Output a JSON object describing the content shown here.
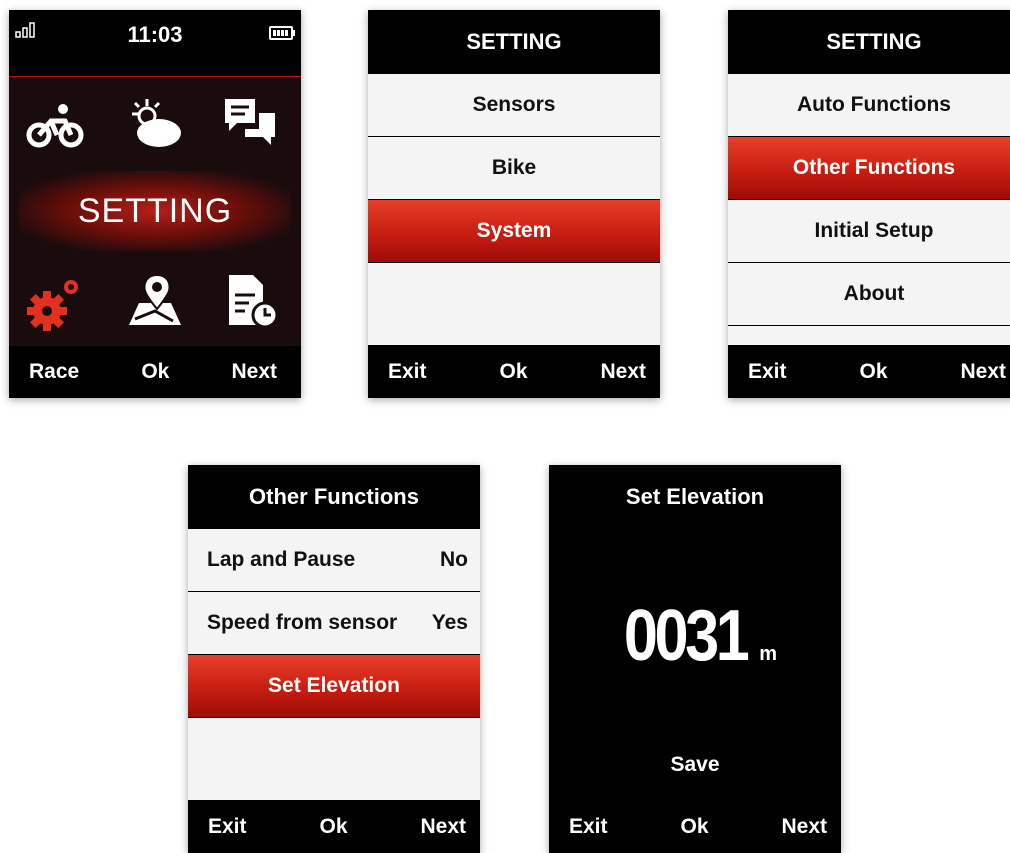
{
  "home": {
    "time": "11:03",
    "banner": "SETTING",
    "icons": [
      "bike-icon",
      "weather-icon",
      "messages-icon",
      "settings-gears-icon",
      "map-pin-icon",
      "document-clock-icon"
    ],
    "footer": {
      "left": "Race",
      "center": "Ok",
      "right": "Next"
    }
  },
  "setting1": {
    "title": "SETTING",
    "items": [
      "Sensors",
      "Bike",
      "System"
    ],
    "selected": "System",
    "footer": {
      "left": "Exit",
      "center": "Ok",
      "right": "Next"
    }
  },
  "setting2": {
    "title": "SETTING",
    "items": [
      "Auto Functions",
      "Other Functions",
      "Initial Setup",
      "About"
    ],
    "selected": "Other Functions",
    "footer": {
      "left": "Exit",
      "center": "Ok",
      "right": "Next"
    }
  },
  "other": {
    "title": "Other Functions",
    "rows": [
      {
        "label": "Lap and Pause",
        "value": "No"
      },
      {
        "label": "Speed from sensor",
        "value": "Yes"
      }
    ],
    "set_elevation": "Set Elevation",
    "footer": {
      "left": "Exit",
      "center": "Ok",
      "right": "Next"
    }
  },
  "elevation": {
    "title": "Set Elevation",
    "value": "0031",
    "unit": "m",
    "save": "Save",
    "footer": {
      "left": "Exit",
      "center": "Ok",
      "right": "Next"
    }
  },
  "colors": {
    "accent": "#c81d12",
    "background": "#000000",
    "menu": "#f4f4f4"
  }
}
